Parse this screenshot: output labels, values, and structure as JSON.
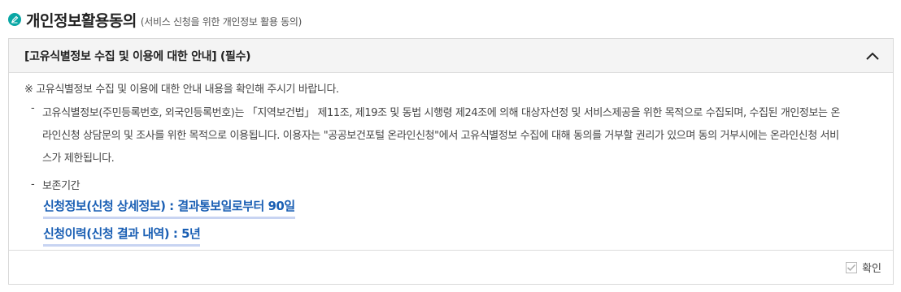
{
  "header": {
    "title": "개인정보활용동의",
    "subtitle": "(서비스 신청을 위한 개인정보 활용 동의)"
  },
  "section": {
    "title": "[고유식별정보 수집 및 이용에 대한 안내] (필수)",
    "notice": "※ 고유식별정보 수집 및 이용에 대한 안내 내용을 확인해 주시기 바랍니다.",
    "dash": "-",
    "items": [
      {
        "text": "고유식별정보(주민등록번호, 외국인등록번호)는 「지역보건법」 제11조, 제19조 및 동법 시행령 제24조에 의해 대상자선정 및 서비스제공을 위한 목적으로 수집되며, 수집된 개인정보는 온라인신청 상담문의 및 조사를 위한 목적으로 이용됩니다. 이용자는 \"공공보건포털 온라인신청\"에서 고유식별정보 수집에 대해 동의를 거부할 권리가 있으며 동의 거부시에는 온라인신청 서비스가 제한됩니다."
      },
      {
        "text": "보존기간"
      }
    ],
    "retention": [
      "신청정보(신청 상세정보) : 결과통보일로부터 90일",
      "신청이력(신청 결과 내역) : 5년"
    ]
  },
  "footer": {
    "confirm_label": "확인",
    "confirm_checked": true
  },
  "icons": {
    "header_icon": "pen-circle-icon",
    "collapse_icon": "chevron-up-icon",
    "check_icon": "checkmark-icon"
  },
  "colors": {
    "accent": "#0aa7a5",
    "link": "#1a5fb4",
    "link_underline": "#c8d4f2"
  }
}
